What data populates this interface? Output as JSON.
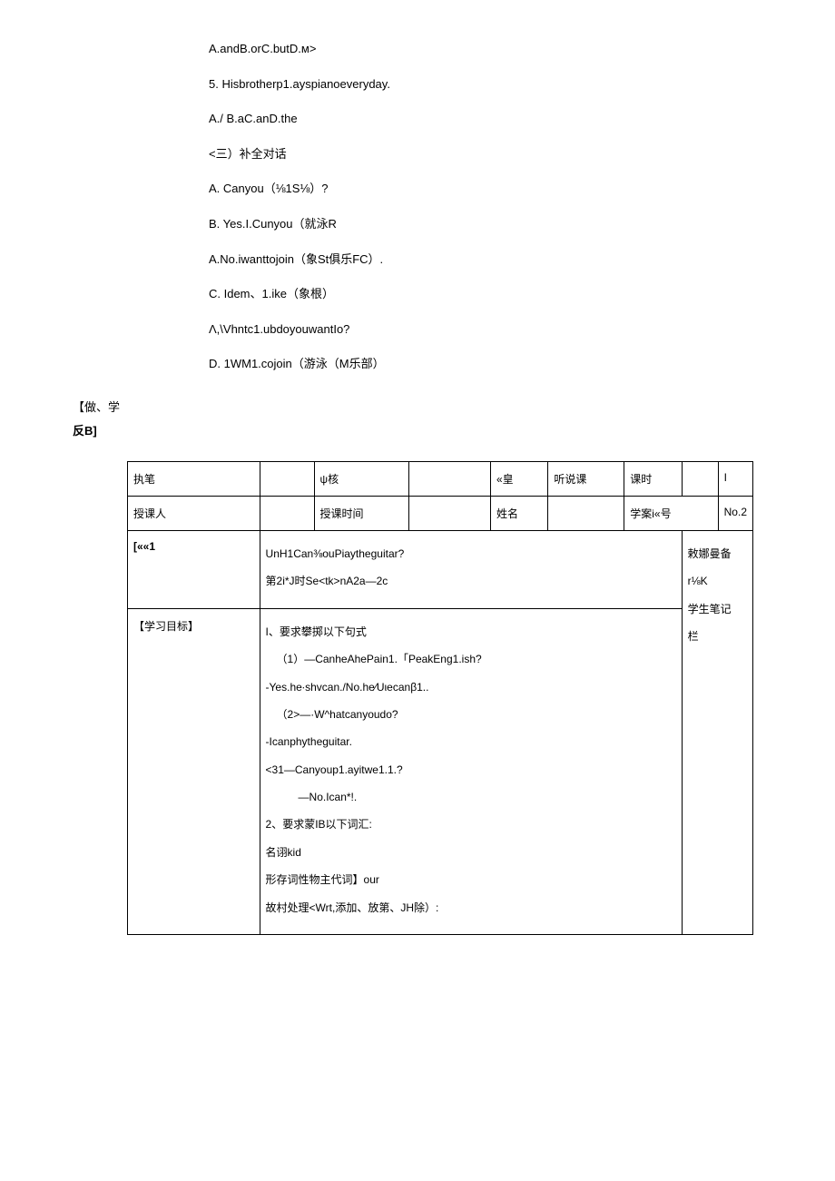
{
  "top": {
    "line1": "A.andB.orC.butD.м>",
    "line2": "5.    Hisbrotherp1.ayspianoeveryday.",
    "line3": "A./                   B.aC.anD.the",
    "line4": "<三）补全对话",
    "line5": "A.    Canyou（⅛1S⅛）?",
    "line6": "B.    Yes.I.Cunyou（就泳R",
    "line7": "A.No.iwanttojoin（象St俱乐FC）.",
    "line8": "C.    Idem、1.ike（象根）",
    "line9": "Λ,\\Vhntc1.ubdoyouwantIo?",
    "line10": "D.    1WM1.cojoin（游泳（M乐部）"
  },
  "left": {
    "line1": "【做、学",
    "line2": "反B]"
  },
  "table": {
    "row1": {
      "c1": "执笔",
      "c2": "",
      "c3": "ψ核",
      "c4": "",
      "c5": "«皇",
      "c6": "听说课",
      "c7": "课时",
      "c8": "",
      "c9": "I"
    },
    "row2": {
      "c1": "授课人",
      "c2": "",
      "c3": "授课时间",
      "c4": "",
      "c5": "姓名",
      "c6": "",
      "c7": "学案i«号",
      "c8": "",
      "c9": "No.2"
    },
    "row3": {
      "c1": "[««1",
      "content": {
        "l1": "UnH1Can⅜ouPiaytheguitar?",
        "l2": "第2i*J时Se<tk>nA2a—2c"
      },
      "right": {
        "l1": "敕娜曼备",
        "l2": "r⅛K",
        "l3": "学生笔记",
        "l4": "栏"
      }
    },
    "row4": {
      "c1": "【学习目标】",
      "content": {
        "l1": "I、要求攀掷以下句式",
        "l2": "（1）—CanheAhePain1.「PeakEng1.ish?",
        "l3": "-Yes.he∙shvcan./No.he∕Uιecanβ1..",
        "l4": "（2>—·W^hatcanyoudo?",
        "l5": "-Icanphytheguitar.",
        "l6": "<31—Canyoup1.ayitwe1.1.?",
        "l7": "—No.Ican*!.",
        "l8": "2、要求蒙IB以下词汇:",
        "l9": "名诩kid",
        "l10": "形存词性物主代词】our",
        "l11": "故村处理<Wrt,添加、放第、JH除）:"
      }
    }
  }
}
